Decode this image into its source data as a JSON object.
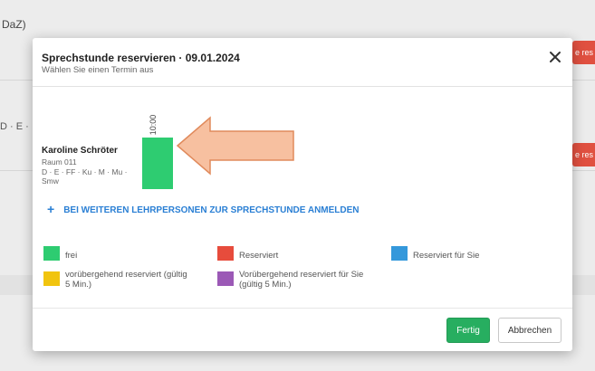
{
  "background": {
    "header_text": "DaZ)",
    "row_text": "D · E ·",
    "badge_label": "e res"
  },
  "dialog": {
    "title": "Sprechstunde reservieren · 09.01.2024",
    "subtitle": "Wählen Sie einen Termin aus",
    "close_icon": "close-icon"
  },
  "schedule": {
    "time": "10:00",
    "slot_color": "#2ecc71",
    "teacher": {
      "name": "Karoline Schröter",
      "room": "Raum 011",
      "subjects": "D · E · FF · Ku · M · Mu · Smw"
    }
  },
  "add_teachers_label": "BEI WEITEREN LEHRPERSONEN ZUR SPRECHSTUNDE ANMELDEN",
  "legend": [
    {
      "label": "frei",
      "color": "#2ecc71"
    },
    {
      "label": "Reserviert",
      "color": "#e74c3c"
    },
    {
      "label": "Reserviert für Sie",
      "color": "#3498db"
    },
    {
      "label": "vorübergehend reserviert (gültig 5 Min.)",
      "color": "#f1c40f"
    },
    {
      "label": "Vorübergehend reserviert für Sie (gültig 5 Min.)",
      "color": "#9b59b6"
    }
  ],
  "footer": {
    "done_label": "Fertig",
    "cancel_label": "Abbrechen"
  },
  "colors": {
    "accent_link": "#2a7fd4",
    "primary_button": "#27ae60",
    "arrow_fill": "#f7c0a0",
    "arrow_stroke": "#e08a5c"
  }
}
